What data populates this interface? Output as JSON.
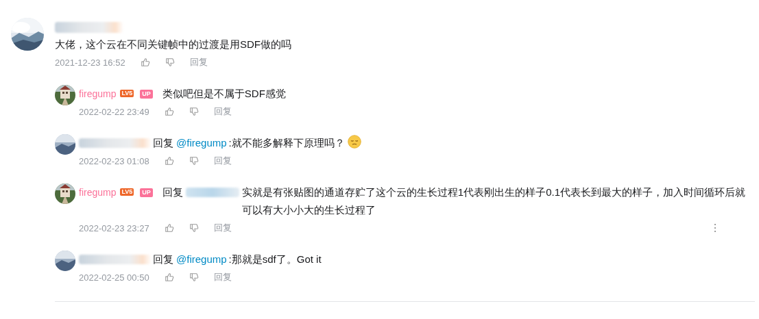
{
  "comment": {
    "author": {
      "redacted": true
    },
    "text": "大佬，这个云在不同关键帧中的过渡是用SDF做的吗",
    "time": "2021-12-23 16:52",
    "reply_action": "回复"
  },
  "replies": [
    {
      "author": {
        "redacted": false,
        "name": "firegump",
        "badges": [
          {
            "kind": "level",
            "label": "LV5"
          },
          {
            "kind": "up",
            "label": "UP"
          }
        ]
      },
      "text": "类似吧但是不属于SDF感觉",
      "emoji": false,
      "time": "2022-02-22 23:49",
      "reply_action": "回复",
      "more_menu": false
    },
    {
      "author": {
        "redacted": true
      },
      "reply_prefix": "回复",
      "mention": {
        "redacted": false,
        "label": "@firegump"
      },
      "text": ":就不能多解释下原理吗？",
      "emoji": true,
      "time": "2022-02-23 01:08",
      "reply_action": "回复",
      "more_menu": false
    },
    {
      "author": {
        "redacted": false,
        "name": "firegump",
        "badges": [
          {
            "kind": "level",
            "label": "LV5"
          },
          {
            "kind": "up",
            "label": "UP"
          }
        ]
      },
      "reply_prefix": "回复",
      "mention": {
        "redacted": true
      },
      "text": "实就是有张贴图的通道存贮了这个云的生长过程1代表刚出生的样子0.1代表长到最大的样子，加入时间循环后就可以有大小小大的生长过程了",
      "emoji": false,
      "time": "2022-02-23 23:27",
      "reply_action": "回复",
      "more_menu": true
    },
    {
      "author": {
        "redacted": true
      },
      "reply_prefix": "回复",
      "mention": {
        "redacted": false,
        "label": "@firegump"
      },
      "text": ":那就是sdf了。Got it",
      "emoji": false,
      "time": "2022-02-25 00:50",
      "reply_action": "回复",
      "more_menu": false
    }
  ]
}
